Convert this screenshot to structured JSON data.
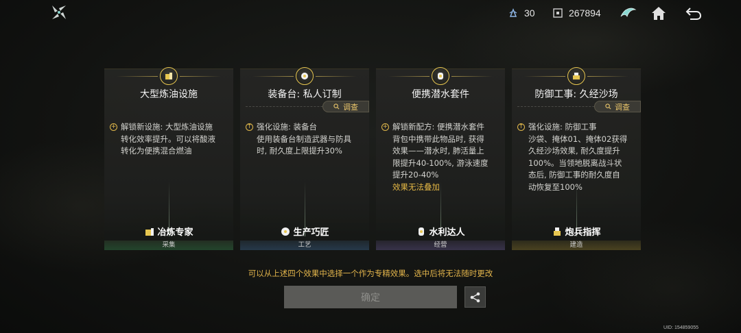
{
  "topbar": {
    "energy_value": "30",
    "currency_value": "267894"
  },
  "cards": [
    {
      "title": "大型炼油设施",
      "has_inspect": false,
      "bullet": "+",
      "desc_lines": [
        "解锁新设施: 大型炼油设施",
        "转化效率提升。可以将酸液",
        "转化为便携混合燃油"
      ],
      "note": "",
      "talent": "冶炼专家",
      "category": "采集",
      "category_color": "green"
    },
    {
      "title": "装备台: 私人订制",
      "has_inspect": true,
      "inspect_label": "调查",
      "bullet": "↑",
      "desc_lines": [
        "强化设施: 装备台",
        "使用装备台制造武器与防具",
        "时, 耐久度上限提升30%"
      ],
      "note": "",
      "talent": "生产巧匠",
      "category": "工艺",
      "category_color": "blue"
    },
    {
      "title": "便携潜水套件",
      "has_inspect": false,
      "bullet": "+",
      "desc_lines": [
        "解锁新配方: 便携潜水套件",
        "背包中携带此物品时, 获得",
        "效果——潜水时, 肺活量上",
        "限提升40-100%, 游泳速度",
        "提升20-40%"
      ],
      "note": "效果无法叠加",
      "talent": "水利达人",
      "category": "经营",
      "category_color": "purple"
    },
    {
      "title": "防御工事: 久经沙场",
      "has_inspect": true,
      "inspect_label": "调查",
      "bullet": "↑",
      "desc_lines": [
        "强化设施: 防御工事",
        "沙袋、掩体01、掩体02获得",
        "久经沙场效果, 耐久度提升",
        "100%。当领地脱离战斗状",
        "态后, 防御工事的耐久度自",
        "动恢复至100%"
      ],
      "note": "",
      "talent": "炮兵指挥",
      "category": "建造",
      "category_color": "gold"
    }
  ],
  "hint": "可以从上述四个效果中选择一个作为专精效果。选中后将无法随时更改",
  "confirm_label": "确定",
  "uid": "UID: 154859055",
  "icons": {
    "logo": "star-logo-icon",
    "energy": "crystal-icon",
    "currency": "box-currency-icon",
    "faction": "wing-emblem-icon",
    "home": "home-icon",
    "back": "return-arrow-icon",
    "share": "share-icon",
    "inspect": "magnifier-icon"
  },
  "colors": {
    "accent_gold": "#e2b44b",
    "button_disabled": "#5a5a57"
  }
}
